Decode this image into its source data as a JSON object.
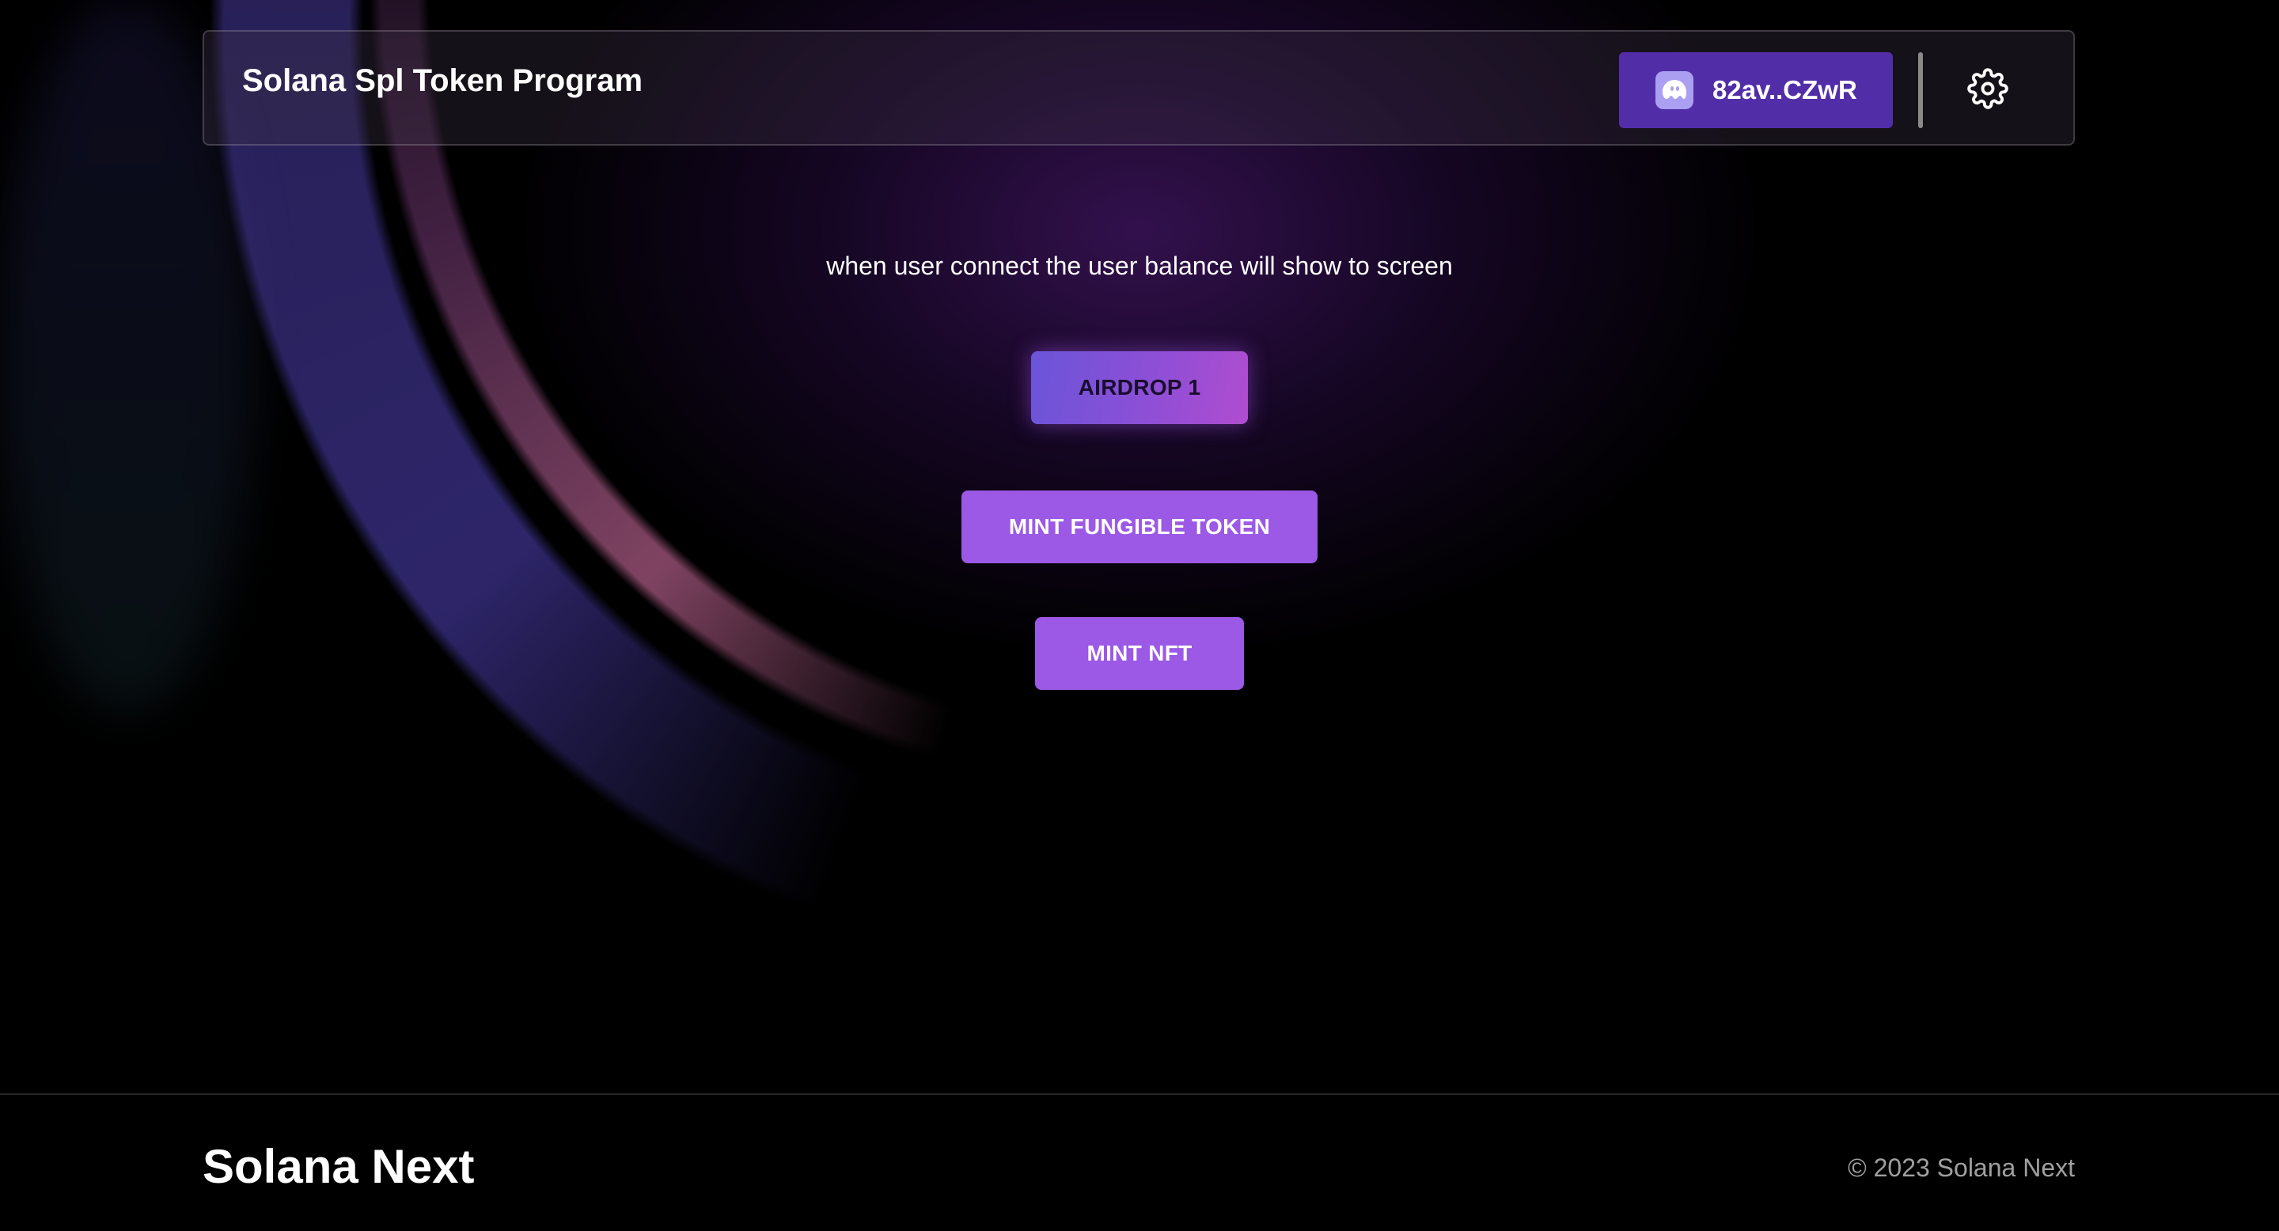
{
  "header": {
    "title": "Solana Spl Token Program",
    "wallet_address": "82av..CZwR",
    "wallet_icon": "phantom-ghost-icon",
    "settings_icon": "gear-icon"
  },
  "main": {
    "info_text": "when user connect the user balance will show to screen",
    "buttons": {
      "airdrop": "AIRDROP 1",
      "mint_fungible": "MINT FUNGIBLE TOKEN",
      "mint_nft": "MINT NFT"
    }
  },
  "footer": {
    "brand": "Solana Next",
    "copyright": "© 2023 Solana Next"
  },
  "colors": {
    "wallet_button": "#512da8",
    "primary_button": "#9b59e6",
    "airdrop_gradient_start": "#6a55d8",
    "airdrop_gradient_end": "#b04dd0",
    "background": "#000000"
  }
}
